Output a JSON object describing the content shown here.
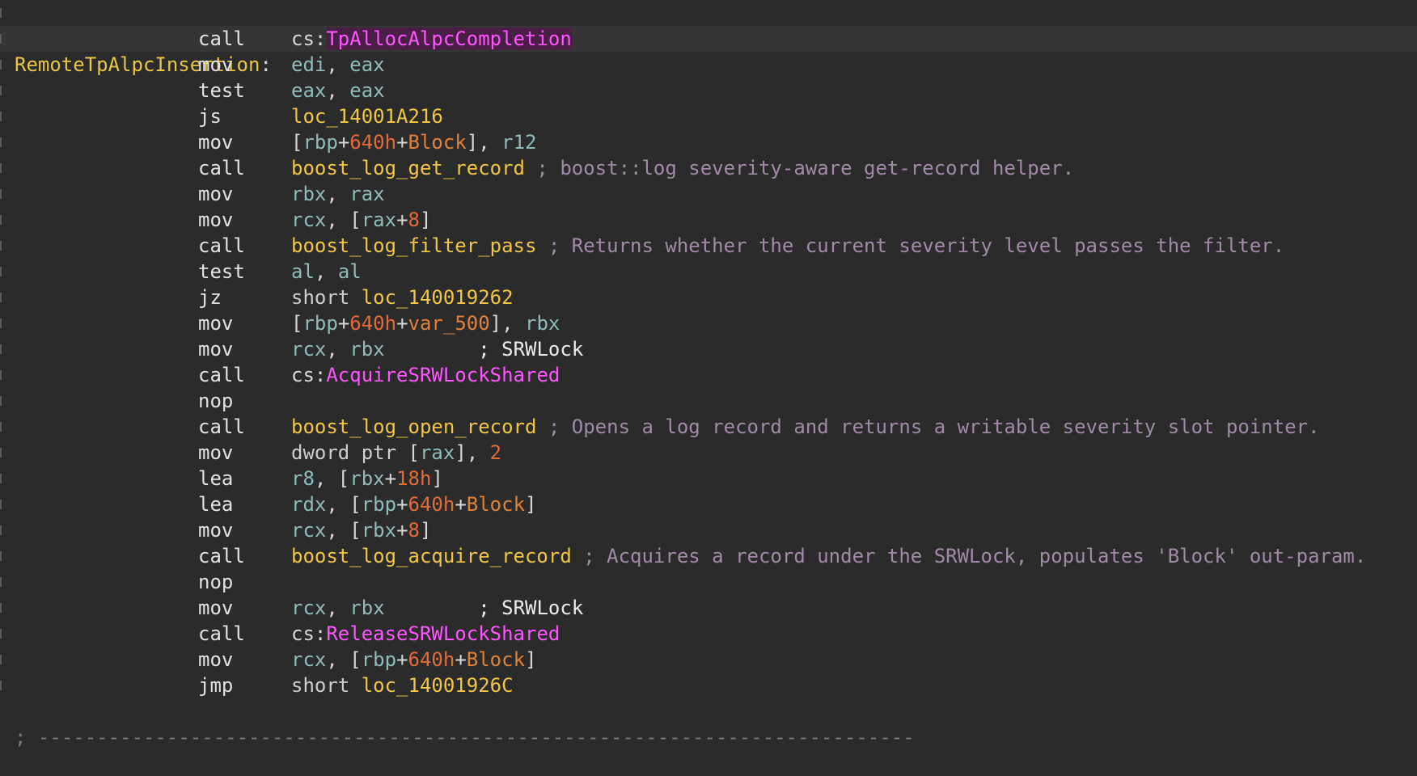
{
  "function_label": "RemoteTpAlpcInsertion",
  "separator": "; ---------------------------------------------------------------------------",
  "instructions": [
    {
      "mnemonic": "call",
      "highlight": true,
      "tokens": [
        {
          "t": "cs:",
          "k": "plain"
        },
        {
          "t": "TpAllocAlpcCompletion",
          "k": "imp-hl"
        }
      ]
    },
    {
      "mnemonic": "mov",
      "tokens": [
        {
          "t": "edi",
          "k": "reg"
        },
        {
          "t": ", ",
          "k": "plain"
        },
        {
          "t": "eax",
          "k": "reg"
        }
      ]
    },
    {
      "mnemonic": "test",
      "tokens": [
        {
          "t": "eax",
          "k": "reg"
        },
        {
          "t": ", ",
          "k": "plain"
        },
        {
          "t": "eax",
          "k": "reg"
        }
      ]
    },
    {
      "mnemonic": "js",
      "tokens": [
        {
          "t": "loc_14001A216",
          "k": "sym"
        }
      ]
    },
    {
      "mnemonic": "mov",
      "tokens": [
        {
          "t": "[",
          "k": "plain"
        },
        {
          "t": "rbp",
          "k": "reg"
        },
        {
          "t": "+",
          "k": "plain"
        },
        {
          "t": "640h",
          "k": "num"
        },
        {
          "t": "+",
          "k": "plain"
        },
        {
          "t": "Block",
          "k": "var"
        },
        {
          "t": "], ",
          "k": "plain"
        },
        {
          "t": "r12",
          "k": "reg"
        }
      ]
    },
    {
      "mnemonic": "call",
      "tokens": [
        {
          "t": "boost_log_get_record",
          "k": "sym"
        },
        {
          "t": " ; boost::log severity-aware get-record helper.",
          "k": "comment"
        }
      ]
    },
    {
      "mnemonic": "mov",
      "tokens": [
        {
          "t": "rbx",
          "k": "reg"
        },
        {
          "t": ", ",
          "k": "plain"
        },
        {
          "t": "rax",
          "k": "reg"
        }
      ]
    },
    {
      "mnemonic": "mov",
      "tokens": [
        {
          "t": "rcx",
          "k": "reg"
        },
        {
          "t": ", [",
          "k": "plain"
        },
        {
          "t": "rax",
          "k": "reg"
        },
        {
          "t": "+",
          "k": "plain"
        },
        {
          "t": "8",
          "k": "num"
        },
        {
          "t": "]",
          "k": "plain"
        }
      ]
    },
    {
      "mnemonic": "call",
      "tokens": [
        {
          "t": "boost_log_filter_pass",
          "k": "sym"
        },
        {
          "t": " ; Returns whether the current severity level passes the filter.",
          "k": "comment"
        }
      ]
    },
    {
      "mnemonic": "test",
      "tokens": [
        {
          "t": "al",
          "k": "reg"
        },
        {
          "t": ", ",
          "k": "plain"
        },
        {
          "t": "al",
          "k": "reg"
        }
      ]
    },
    {
      "mnemonic": "jz",
      "tokens": [
        {
          "t": "short ",
          "k": "kw"
        },
        {
          "t": "loc_140019262",
          "k": "sym"
        }
      ]
    },
    {
      "mnemonic": "mov",
      "tokens": [
        {
          "t": "[",
          "k": "plain"
        },
        {
          "t": "rbp",
          "k": "reg"
        },
        {
          "t": "+",
          "k": "plain"
        },
        {
          "t": "640h",
          "k": "num"
        },
        {
          "t": "+",
          "k": "plain"
        },
        {
          "t": "var_500",
          "k": "var"
        },
        {
          "t": "], ",
          "k": "plain"
        },
        {
          "t": "rbx",
          "k": "reg"
        }
      ]
    },
    {
      "mnemonic": "mov",
      "tokens": [
        {
          "t": "rcx",
          "k": "reg"
        },
        {
          "t": ", ",
          "k": "plain"
        },
        {
          "t": "rbx",
          "k": "reg"
        },
        {
          "t": "        ; SRWLock",
          "k": "lockcmt"
        }
      ]
    },
    {
      "mnemonic": "call",
      "tokens": [
        {
          "t": "cs:",
          "k": "plain"
        },
        {
          "t": "AcquireSRWLockShared",
          "k": "imp"
        }
      ]
    },
    {
      "mnemonic": "nop",
      "tokens": []
    },
    {
      "mnemonic": "call",
      "tokens": [
        {
          "t": "boost_log_open_record",
          "k": "sym"
        },
        {
          "t": " ; Opens a log record and returns a writable severity slot pointer.",
          "k": "comment"
        }
      ]
    },
    {
      "mnemonic": "mov",
      "tokens": [
        {
          "t": "dword ptr ",
          "k": "kw"
        },
        {
          "t": "[",
          "k": "plain"
        },
        {
          "t": "rax",
          "k": "reg"
        },
        {
          "t": "], ",
          "k": "plain"
        },
        {
          "t": "2",
          "k": "num"
        }
      ]
    },
    {
      "mnemonic": "lea",
      "tokens": [
        {
          "t": "r8",
          "k": "reg"
        },
        {
          "t": ", [",
          "k": "plain"
        },
        {
          "t": "rbx",
          "k": "reg"
        },
        {
          "t": "+",
          "k": "plain"
        },
        {
          "t": "18h",
          "k": "num"
        },
        {
          "t": "]",
          "k": "plain"
        }
      ]
    },
    {
      "mnemonic": "lea",
      "tokens": [
        {
          "t": "rdx",
          "k": "reg"
        },
        {
          "t": ", [",
          "k": "plain"
        },
        {
          "t": "rbp",
          "k": "reg"
        },
        {
          "t": "+",
          "k": "plain"
        },
        {
          "t": "640h",
          "k": "num"
        },
        {
          "t": "+",
          "k": "plain"
        },
        {
          "t": "Block",
          "k": "var"
        },
        {
          "t": "]",
          "k": "plain"
        }
      ]
    },
    {
      "mnemonic": "mov",
      "tokens": [
        {
          "t": "rcx",
          "k": "reg"
        },
        {
          "t": ", [",
          "k": "plain"
        },
        {
          "t": "rbx",
          "k": "reg"
        },
        {
          "t": "+",
          "k": "plain"
        },
        {
          "t": "8",
          "k": "num"
        },
        {
          "t": "]",
          "k": "plain"
        }
      ]
    },
    {
      "mnemonic": "call",
      "tokens": [
        {
          "t": "boost_log_acquire_record",
          "k": "sym"
        },
        {
          "t": " ; Acquires a record under the SRWLock, populates 'Block' out-param.",
          "k": "comment"
        }
      ]
    },
    {
      "mnemonic": "nop",
      "tokens": []
    },
    {
      "mnemonic": "mov",
      "tokens": [
        {
          "t": "rcx",
          "k": "reg"
        },
        {
          "t": ", ",
          "k": "plain"
        },
        {
          "t": "rbx",
          "k": "reg"
        },
        {
          "t": "        ; SRWLock",
          "k": "lockcmt"
        }
      ]
    },
    {
      "mnemonic": "call",
      "tokens": [
        {
          "t": "cs:",
          "k": "plain"
        },
        {
          "t": "ReleaseSRWLockShared",
          "k": "imp"
        }
      ]
    },
    {
      "mnemonic": "mov",
      "tokens": [
        {
          "t": "rcx",
          "k": "reg"
        },
        {
          "t": ", [",
          "k": "plain"
        },
        {
          "t": "rbp",
          "k": "reg"
        },
        {
          "t": "+",
          "k": "plain"
        },
        {
          "t": "640h",
          "k": "num"
        },
        {
          "t": "+",
          "k": "plain"
        },
        {
          "t": "Block",
          "k": "var"
        },
        {
          "t": "]",
          "k": "plain"
        }
      ]
    },
    {
      "mnemonic": "jmp",
      "tokens": [
        {
          "t": "short ",
          "k": "kw"
        },
        {
          "t": "loc_14001926C",
          "k": "sym"
        }
      ]
    }
  ]
}
